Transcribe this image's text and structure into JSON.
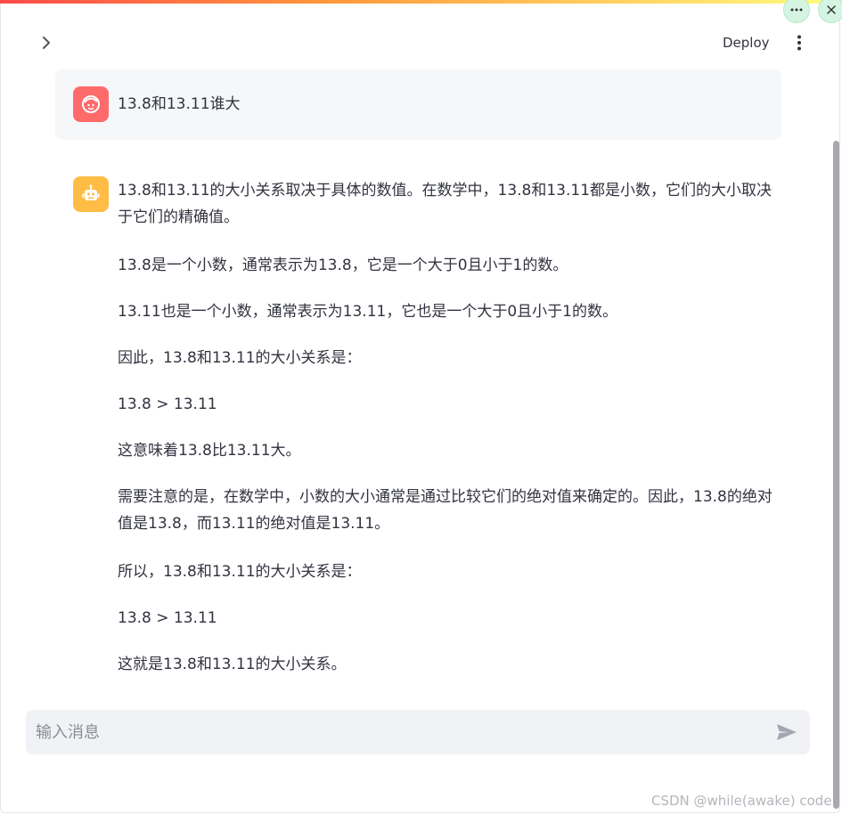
{
  "header": {
    "deploy_label": "Deploy",
    "sidebar_toggle_icon": "chevron-right-icon",
    "menu_icon": "kebab-menu-icon"
  },
  "window_controls": {
    "more_icon": "ellipsis-icon",
    "close_icon": "close-icon"
  },
  "chat": {
    "user_message": {
      "avatar_icon": "user-face-icon",
      "text": "13.8和13.11谁大"
    },
    "assistant_message": {
      "avatar_icon": "robot-icon",
      "paragraphs": [
        "13.8和13.11的大小关系取决于具体的数值。在数学中，13.8和13.11都是小数，它们的大小取决于它们的精确值。",
        "13.8是一个小数，通常表示为13.8，它是一个大于0且小于1的数。",
        "13.11也是一个小数，通常表示为13.11，它也是一个大于0且小于1的数。",
        "因此，13.8和13.11的大小关系是：",
        "13.8 > 13.11",
        "这意味着13.8比13.11大。",
        "需要注意的是，在数学中，小数的大小通常是通过比较它们的绝对值来确定的。因此，13.8的绝对值是13.8，而13.11的绝对值是13.11。",
        "所以，13.8和13.11的大小关系是：",
        "13.8 > 13.11",
        "这就是13.8和13.11的大小关系。"
      ]
    }
  },
  "input": {
    "placeholder": "输入消息",
    "value": "",
    "send_icon": "send-icon"
  },
  "watermark": "CSDN @while(awake) code",
  "colors": {
    "user_avatar": "#ff6b6b",
    "bot_avatar": "#ffbd45",
    "input_bg": "#f0f2f6",
    "user_bubble_bg": "#f6f7f9"
  }
}
